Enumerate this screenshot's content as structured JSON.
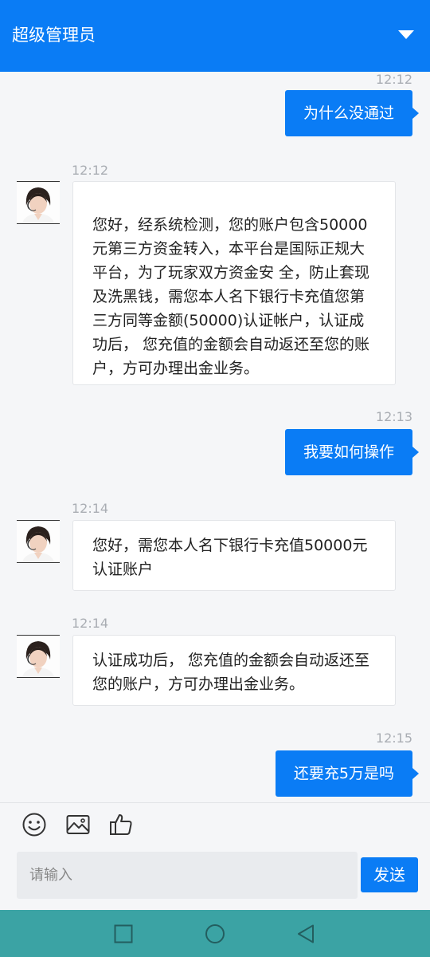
{
  "header": {
    "title": "超级管理员",
    "dropdown_icon": "chevron-down-icon"
  },
  "messages": [
    {
      "side": "out",
      "time": "12:12",
      "text": "为什么没通过"
    },
    {
      "side": "in",
      "time": "12:12",
      "lines": [
        "您好，经系统检测，您的账户包含50000",
        "元第三方资金转入，本平台是国际正规大",
        "平台，为了玩家双方资金安 全，防止套现",
        "及洗黑钱，需您本人名下银行卡充值您第",
        "三方同等金额(50000)认证帐户，认证成",
        "功后， 您充值的金额会自动返还至您的账",
        "户，方可办理出金业务。"
      ]
    },
    {
      "side": "out",
      "time": "12:13",
      "text": "我要如何操作"
    },
    {
      "side": "in",
      "time": "12:14",
      "lines": [
        "您好，需您本人名下银行卡充值50000元",
        "认证账户"
      ]
    },
    {
      "side": "in",
      "time": "12:14",
      "lines": [
        "认证成功后， 您充值的金额会自动返还至",
        "您的账户，方可办理出金业务。"
      ]
    },
    {
      "side": "out",
      "time": "12:15",
      "text": "还要充5万是吗"
    }
  ],
  "composer": {
    "placeholder": "请输入",
    "send_label": "发送",
    "icons": [
      "emoji-icon",
      "image-icon",
      "thumbs-up-icon"
    ]
  },
  "navbar": {
    "icons": [
      "recent-apps-icon",
      "home-icon",
      "back-icon"
    ]
  },
  "colors": {
    "accent": "#0a7cf5",
    "navbar": "#3ba3a4"
  }
}
